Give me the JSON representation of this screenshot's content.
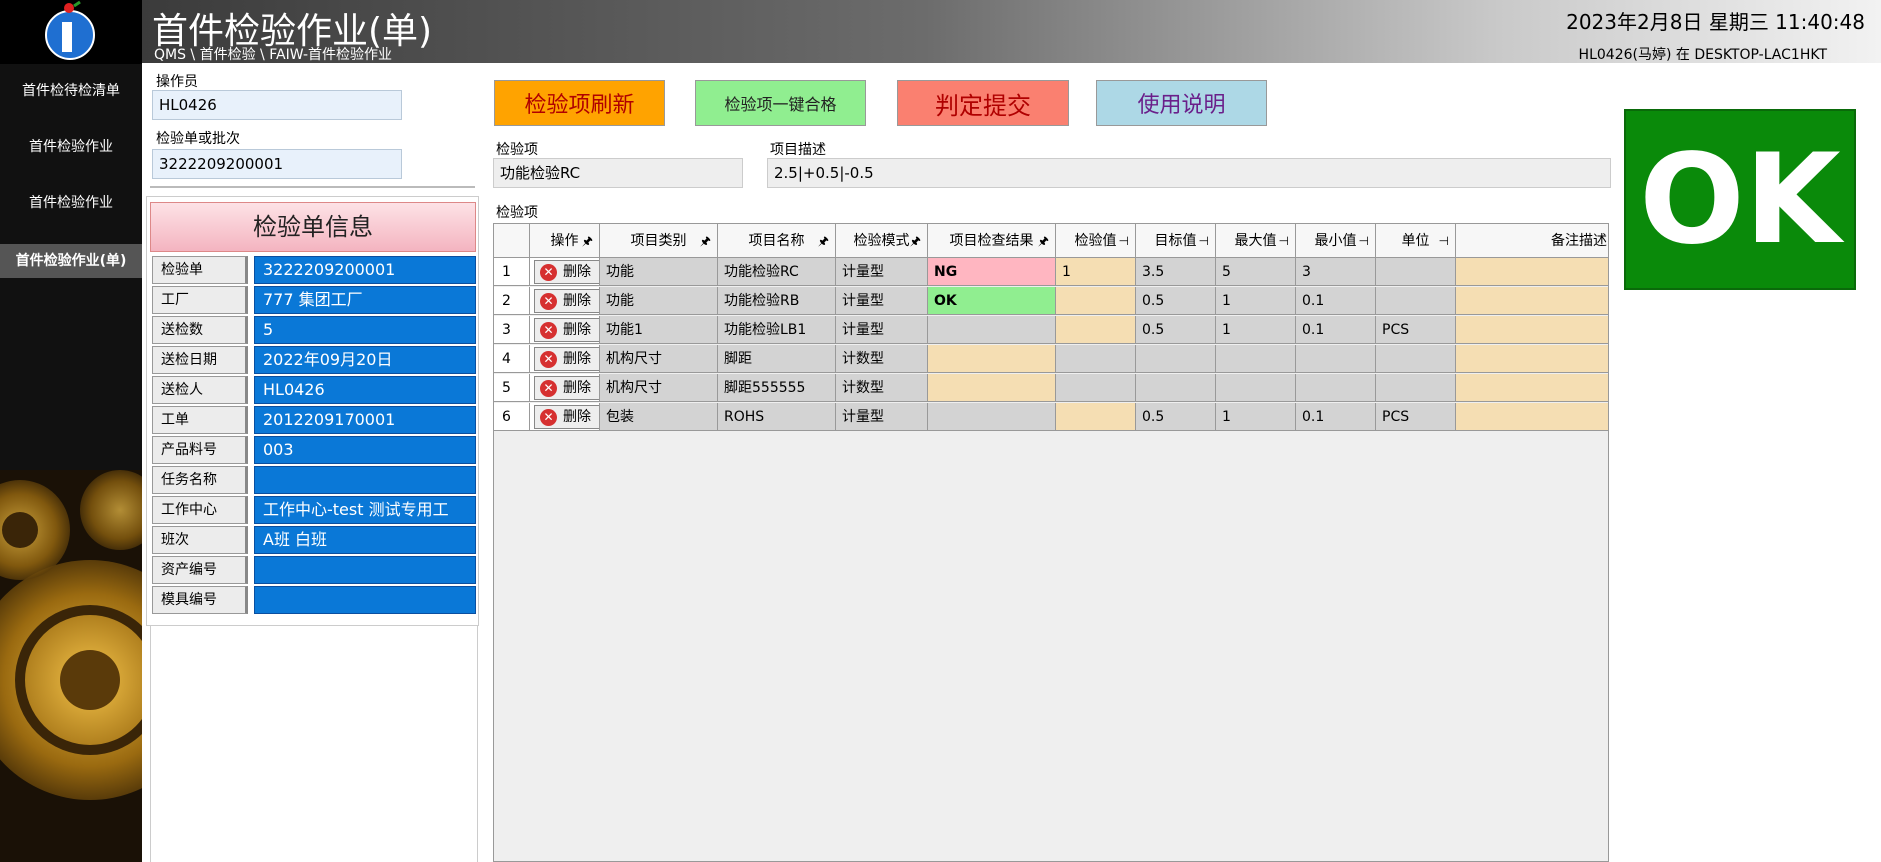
{
  "sidebar": {
    "items": [
      {
        "label": "首件检待检清单",
        "active": false
      },
      {
        "label": "首件检验作业",
        "active": false
      },
      {
        "label": "首件检验作业",
        "active": false
      },
      {
        "label": "首件检验作业(单)",
        "active": true
      }
    ]
  },
  "header": {
    "title": "首件检验作业(单)",
    "breadcrumb": "QMS \\ 首件检验 \\ FAIW-首件检验作业",
    "datetime": "2023年2月8日 星期三 11:40:48",
    "user_info": "HL0426(马婷) 在 DESKTOP-LAC1HKT"
  },
  "form": {
    "operator_label": "操作员",
    "operator_value": "HL0426",
    "order_label": "检验单或批次",
    "order_value": "3222209200001"
  },
  "info": {
    "title": "检验单信息",
    "rows": [
      {
        "label": "检验单",
        "value": "3222209200001"
      },
      {
        "label": "工厂",
        "value": "777 集团工厂"
      },
      {
        "label": "送检数",
        "value": "5"
      },
      {
        "label": "送检日期",
        "value": "2022年09月20日"
      },
      {
        "label": "送检人",
        "value": "HL0426"
      },
      {
        "label": "工单",
        "value": "2012209170001"
      },
      {
        "label": "产品料号",
        "value": "003"
      },
      {
        "label": "任务名称",
        "value": ""
      },
      {
        "label": "工作中心",
        "value": "工作中心-test 测试专用工"
      },
      {
        "label": "班次",
        "value": "A班 白班"
      },
      {
        "label": "资产编号",
        "value": ""
      },
      {
        "label": "模具编号",
        "value": ""
      }
    ]
  },
  "toolbar": {
    "refresh_label": "检验项刷新",
    "pass_all_label": "检验项一键合格",
    "submit_label": "判定提交",
    "help_label": "使用说明"
  },
  "item": {
    "item_label": "检验项",
    "item_value": "功能检验RC",
    "desc_label": "项目描述",
    "desc_value": "2.5|+0.5|-0.5",
    "grid_label": "检验项"
  },
  "grid": {
    "columns": [
      "操作",
      "项目类别",
      "项目名称",
      "检验模式",
      "项目检查结果",
      "检验值",
      "目标值",
      "最大值",
      "最小值",
      "单位",
      "备注描述"
    ],
    "pins": [
      "🖈",
      "🖈",
      "🖈",
      "🖈",
      "🖈",
      "⊣",
      "⊣",
      "⊣",
      "⊣",
      "⊣"
    ],
    "delete_label": "删除",
    "delete_icon": "✕",
    "rows": [
      {
        "no": "1",
        "category": "功能",
        "name": "功能检验RC",
        "mode": "计量型",
        "result": "NG",
        "value": "1",
        "target": "3.5",
        "max": "5",
        "min": "3",
        "unit": "",
        "remark": ""
      },
      {
        "no": "2",
        "category": "功能",
        "name": "功能检验RB",
        "mode": "计量型",
        "result": "OK",
        "value": "",
        "target": "0.5",
        "max": "1",
        "min": "0.1",
        "unit": "",
        "remark": ""
      },
      {
        "no": "3",
        "category": "功能1",
        "name": "功能检验LB1",
        "mode": "计量型",
        "result": "",
        "value": "",
        "target": "0.5",
        "max": "1",
        "min": "0.1",
        "unit": "PCS",
        "remark": ""
      },
      {
        "no": "4",
        "category": "机构尺寸",
        "name": "脚距",
        "mode": "计数型",
        "result": "",
        "value": "",
        "target": "",
        "max": "",
        "min": "",
        "unit": "",
        "remark": ""
      },
      {
        "no": "5",
        "category": "机构尺寸",
        "name": "脚距555555",
        "mode": "计数型",
        "result": "",
        "value": "",
        "target": "",
        "max": "",
        "min": "",
        "unit": "",
        "remark": ""
      },
      {
        "no": "6",
        "category": "包装",
        "name": "ROHS",
        "mode": "计量型",
        "result": "",
        "value": "",
        "target": "0.5",
        "max": "1",
        "min": "0.1",
        "unit": "PCS",
        "remark": ""
      }
    ]
  },
  "status": {
    "result": "OK",
    "color": "#0a8a0a"
  }
}
